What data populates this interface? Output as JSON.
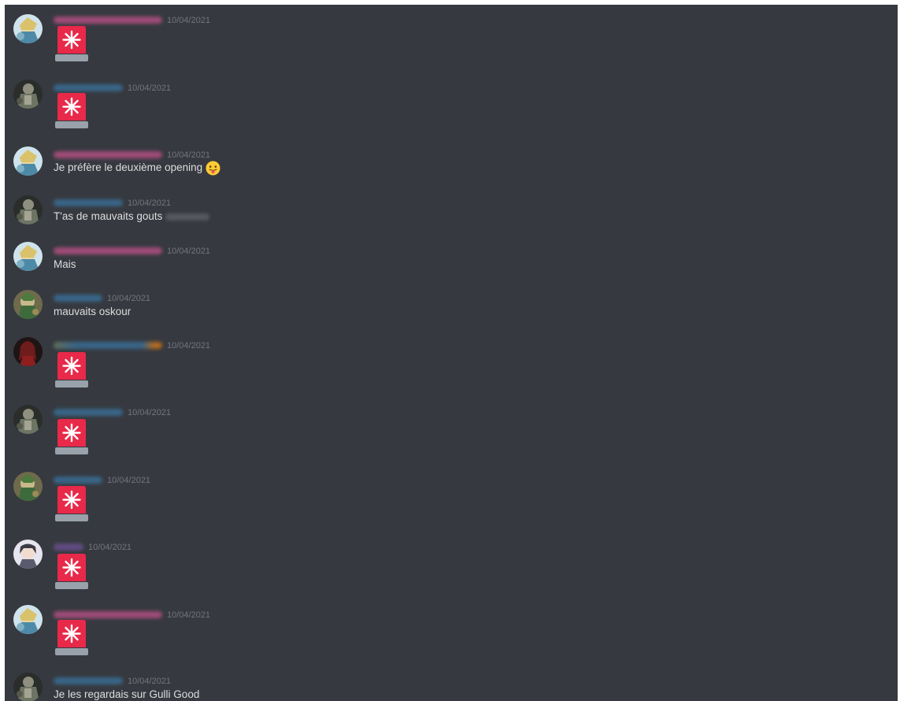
{
  "chat": {
    "messages": [
      {
        "author_style": "pink",
        "avatar": "avatar-a",
        "time": "10/04/2021",
        "content": "siren-emoji"
      },
      {
        "author_style": "blue",
        "avatar": "avatar-b",
        "time": "10/04/2021",
        "content": "siren-emoji"
      },
      {
        "author_style": "pink",
        "avatar": "avatar-a",
        "time": "10/04/2021",
        "text": "Je préfère le deuxième opening",
        "emoji": "tongue-emoji"
      },
      {
        "author_style": "blue",
        "avatar": "avatar-b",
        "time": "10/04/2021",
        "text": "T'as de mauvaits gouts"
      },
      {
        "author_style": "pink",
        "avatar": "avatar-a",
        "time": "10/04/2021",
        "text": "Mais"
      },
      {
        "author_style": "blue",
        "avatar": "avatar-c",
        "time": "10/04/2021",
        "text": "mauvaits oskour"
      },
      {
        "author_style": "mixed",
        "avatar": "avatar-d",
        "time": "10/04/2021",
        "content": "siren-emoji"
      },
      {
        "author_style": "blue",
        "avatar": "avatar-b",
        "time": "10/04/2021",
        "content": "siren-emoji"
      },
      {
        "author_style": "blue",
        "avatar": "avatar-c",
        "time": "10/04/2021",
        "content": "siren-emoji"
      },
      {
        "author_style": "purple",
        "avatar": "avatar-e",
        "time": "10/04/2021",
        "content": "siren-emoji"
      },
      {
        "author_style": "pink",
        "avatar": "avatar-a",
        "time": "10/04/2021",
        "content": "siren-emoji"
      },
      {
        "author_style": "blue",
        "avatar": "avatar-b",
        "time": "10/04/2021",
        "text": "Je les regardais sur Gulli Good"
      }
    ]
  },
  "colors": {
    "background": "#36393f",
    "text": "#dcddde",
    "timestamp": "#72767d",
    "siren_red": "#e8294a",
    "siren_base": "#99a1ab"
  }
}
